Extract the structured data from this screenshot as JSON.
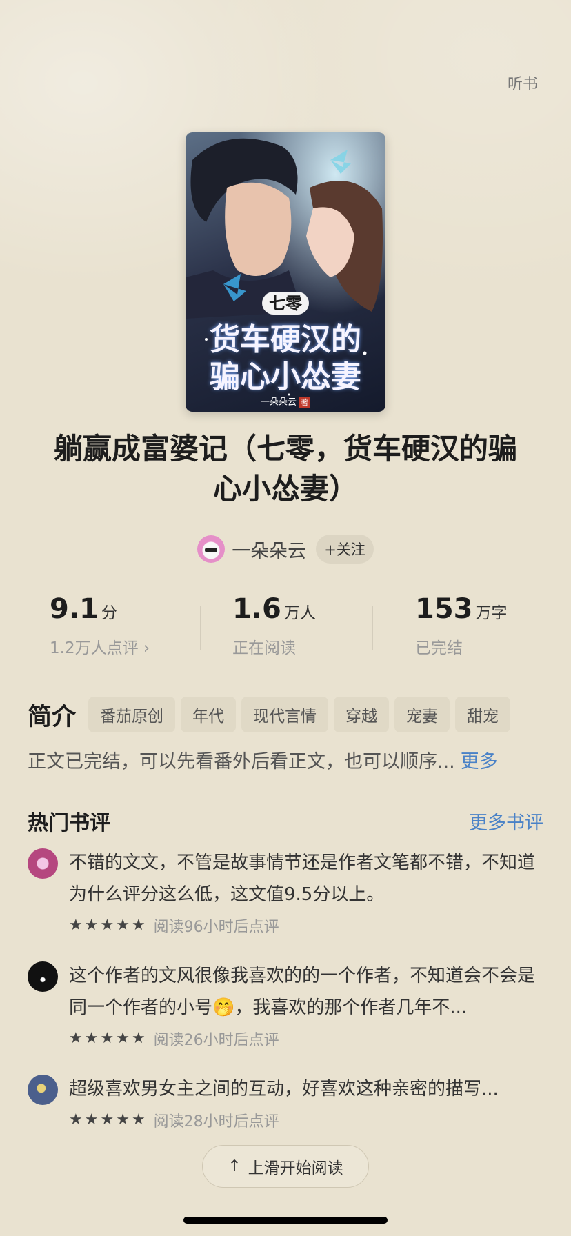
{
  "header": {
    "listen_label": "听书"
  },
  "cover": {
    "badge": "七零",
    "title_line1": "货车硬汉的",
    "title_line2": "骗心小怂妻",
    "author": "一朵朵云",
    "author_tag": "著"
  },
  "book": {
    "title": "躺赢成富婆记（七零，货车硬汉的骗心小怂妻）"
  },
  "author": {
    "name": "一朵朵云",
    "follow_label": "+关注"
  },
  "stats": {
    "score": "9.1",
    "score_unit": "分",
    "score_sub": "1.2万人点评 ›",
    "readers": "1.6",
    "readers_unit": "万人",
    "readers_sub": "正在阅读",
    "words": "153",
    "words_unit": "万字",
    "words_sub": "已完结"
  },
  "intro": {
    "heading": "简介",
    "tags": [
      "番茄原创",
      "年代",
      "现代言情",
      "穿越",
      "宠妻",
      "甜宠"
    ],
    "text": "正文已完结，可以先看番外后看正文，也可以顺序...",
    "more_label": "更多"
  },
  "reviews": {
    "title": "热门书评",
    "more_label": "更多书评",
    "items": [
      {
        "text": "不错的文文，不管是故事情节还是作者文笔都不错，不知道为什么评分这么低，这文值9.5分以上。",
        "meta": "阅读96小时后点评",
        "stars": 5
      },
      {
        "text": "这个作者的文风很像我喜欢的的一个作者，不知道会不会是同一个作者的小号🤭，我喜欢的那个作者几年不...",
        "meta": "阅读26小时后点评",
        "stars": 5
      },
      {
        "text": "超级喜欢男女主之间的互动，好喜欢这种亲密的描写...",
        "meta": "阅读28小时后点评",
        "stars": 5
      }
    ]
  },
  "footer": {
    "start_read_label": "上滑开始阅读"
  }
}
